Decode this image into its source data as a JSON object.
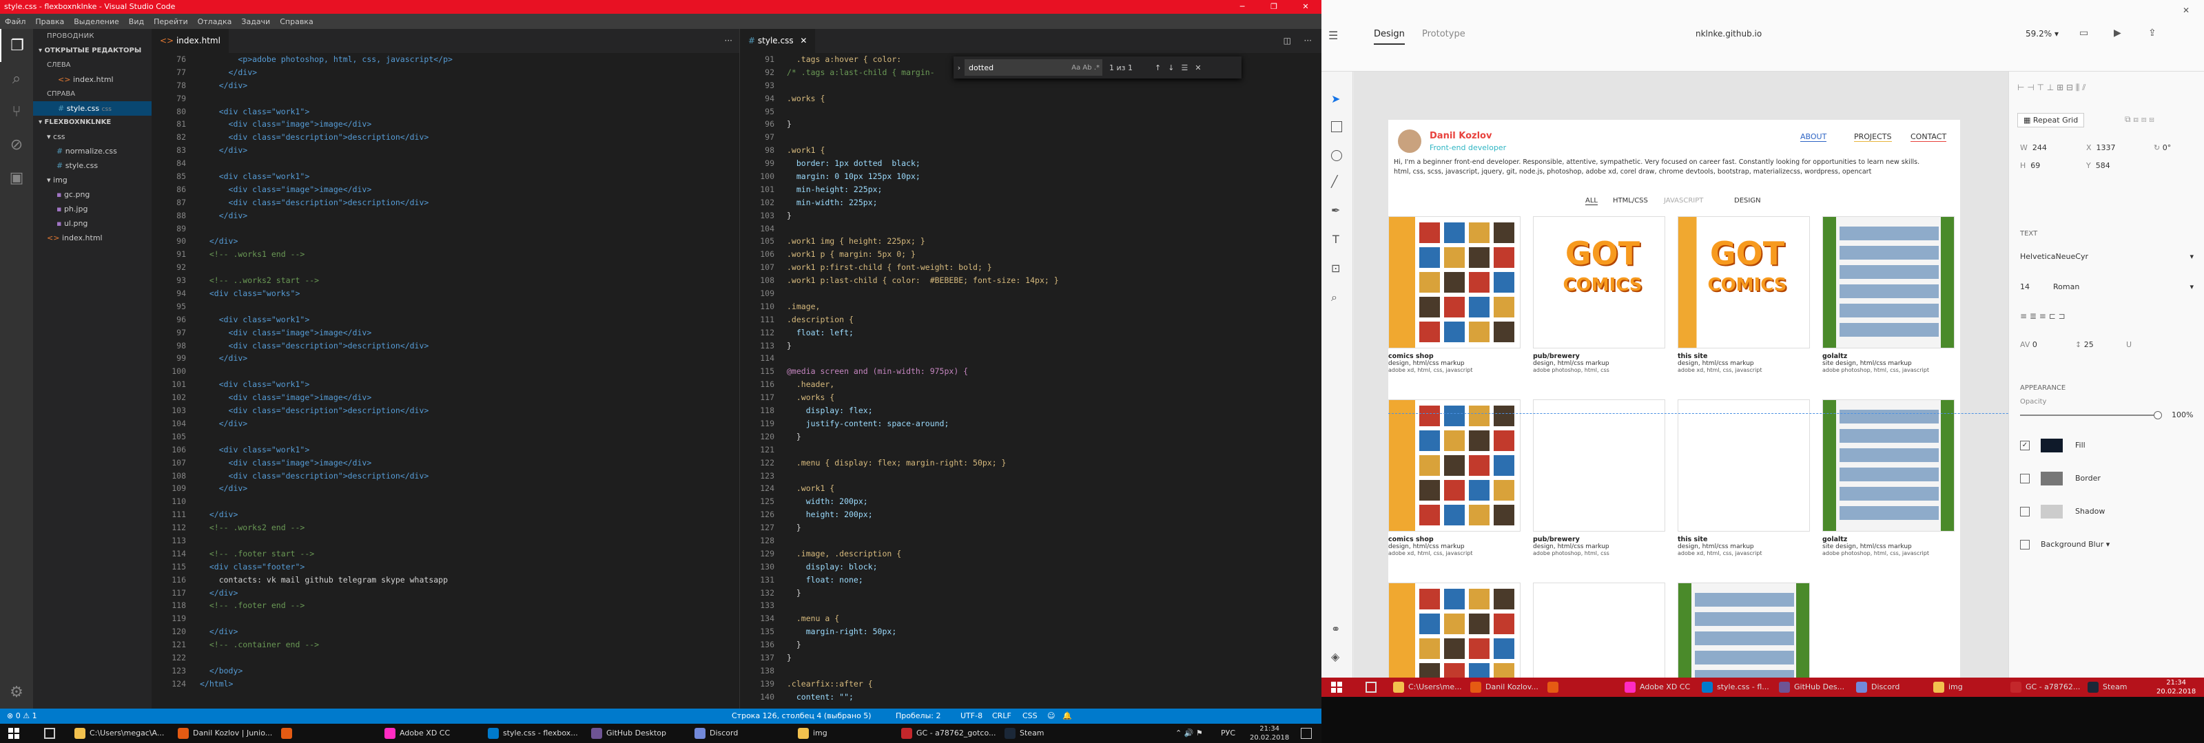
{
  "vscode": {
    "window_title": "style.css - flexboxnklnke - Visual Studio Code",
    "menu": [
      "Файл",
      "Правка",
      "Выделение",
      "Вид",
      "Перейти",
      "Отладка",
      "Задачи",
      "Справка"
    ],
    "explorer": {
      "title": "ПРОВОДНИК",
      "open_editors": "ОТКРЫТЫЕ РЕДАКТОРЫ",
      "group_left": "СЛЕВА",
      "left_file": "index.html",
      "group_right": "СПРАВА",
      "right_file": "style.css",
      "right_file_path": "css",
      "project": "FLEXBOXNKLNKE",
      "tree": [
        {
          "label": "css",
          "indent": 1,
          "type": "folder"
        },
        {
          "label": "normalize.css",
          "indent": 2,
          "type": "css"
        },
        {
          "label": "style.css",
          "indent": 2,
          "type": "css"
        },
        {
          "label": "img",
          "indent": 1,
          "type": "folder"
        },
        {
          "label": "gc.png",
          "indent": 2,
          "type": "img"
        },
        {
          "label": "ph.jpg",
          "indent": 2,
          "type": "img"
        },
        {
          "label": "ul.png",
          "indent": 2,
          "type": "img"
        },
        {
          "label": "index.html",
          "indent": 1,
          "type": "html"
        }
      ]
    },
    "left_tab": "index.html",
    "right_tab": "style.css",
    "html_lines": [
      {
        "n": "76",
        "t": "        <p>adobe photoshop, html, css, javascript</p>"
      },
      {
        "n": "77",
        "t": "      </div>"
      },
      {
        "n": "78",
        "t": "    </div>"
      },
      {
        "n": "79",
        "t": ""
      },
      {
        "n": "80",
        "t": "    <div class=\"work1\">"
      },
      {
        "n": "81",
        "t": "      <div class=\"image\">image</div>"
      },
      {
        "n": "82",
        "t": "      <div class=\"description\">description</div>"
      },
      {
        "n": "83",
        "t": "    </div>"
      },
      {
        "n": "84",
        "t": ""
      },
      {
        "n": "85",
        "t": "    <div class=\"work1\">"
      },
      {
        "n": "86",
        "t": "      <div class=\"image\">image</div>"
      },
      {
        "n": "87",
        "t": "      <div class=\"description\">description</div>"
      },
      {
        "n": "88",
        "t": "    </div>"
      },
      {
        "n": "89",
        "t": ""
      },
      {
        "n": "90",
        "t": "  </div>"
      },
      {
        "n": "91",
        "t": "  <!-- .works1 end -->"
      },
      {
        "n": "92",
        "t": ""
      },
      {
        "n": "93",
        "t": "  <!-- ..works2 start -->"
      },
      {
        "n": "94",
        "t": "  <div class=\"works\">"
      },
      {
        "n": "95",
        "t": ""
      },
      {
        "n": "96",
        "t": "    <div class=\"work1\">"
      },
      {
        "n": "97",
        "t": "      <div class=\"image\">image</div>"
      },
      {
        "n": "98",
        "t": "      <div class=\"description\">description</div>"
      },
      {
        "n": "99",
        "t": "    </div>"
      },
      {
        "n": "100",
        "t": ""
      },
      {
        "n": "101",
        "t": "    <div class=\"work1\">"
      },
      {
        "n": "102",
        "t": "      <div class=\"image\">image</div>"
      },
      {
        "n": "103",
        "t": "      <div class=\"description\">description</div>"
      },
      {
        "n": "104",
        "t": "    </div>"
      },
      {
        "n": "105",
        "t": ""
      },
      {
        "n": "106",
        "t": "    <div class=\"work1\">"
      },
      {
        "n": "107",
        "t": "      <div class=\"image\">image</div>"
      },
      {
        "n": "108",
        "t": "      <div class=\"description\">description</div>"
      },
      {
        "n": "109",
        "t": "    </div>"
      },
      {
        "n": "110",
        "t": ""
      },
      {
        "n": "111",
        "t": "  </div>"
      },
      {
        "n": "112",
        "t": "  <!-- .works2 end -->"
      },
      {
        "n": "113",
        "t": ""
      },
      {
        "n": "114",
        "t": "  <!-- .footer start -->"
      },
      {
        "n": "115",
        "t": "  <div class=\"footer\">"
      },
      {
        "n": "116",
        "t": "    contacts: vk mail github telegram skype whatsapp"
      },
      {
        "n": "117",
        "t": "  </div>"
      },
      {
        "n": "118",
        "t": "  <!-- .footer end -->"
      },
      {
        "n": "119",
        "t": ""
      },
      {
        "n": "120",
        "t": "  </div>"
      },
      {
        "n": "121",
        "t": "  <!-- .container end -->"
      },
      {
        "n": "122",
        "t": ""
      },
      {
        "n": "123",
        "t": "  </body>"
      },
      {
        "n": "124",
        "t": "</html>"
      }
    ],
    "css_lines": [
      {
        "n": "91",
        "t": "  .tags a:hover { color: "
      },
      {
        "n": "92",
        "t": "/* .tags a:last-child { margin-"
      },
      {
        "n": "93",
        "t": ""
      },
      {
        "n": "94",
        "t": ".works {"
      },
      {
        "n": "95",
        "t": ""
      },
      {
        "n": "96",
        "t": "}"
      },
      {
        "n": "97",
        "t": ""
      },
      {
        "n": "98",
        "t": ".work1 {"
      },
      {
        "n": "99",
        "t": "  border: 1px dotted  black;"
      },
      {
        "n": "100",
        "t": "  margin: 0 10px 125px 10px;"
      },
      {
        "n": "101",
        "t": "  min-height: 225px;"
      },
      {
        "n": "102",
        "t": "  min-width: 225px;"
      },
      {
        "n": "103",
        "t": "}"
      },
      {
        "n": "104",
        "t": ""
      },
      {
        "n": "105",
        "t": ".work1 img { height: 225px; }"
      },
      {
        "n": "106",
        "t": ".work1 p { margin: 5px 0; }"
      },
      {
        "n": "107",
        "t": ".work1 p:first-child { font-weight: bold; }"
      },
      {
        "n": "108",
        "t": ".work1 p:last-child { color:  #BEBEBE; font-size: 14px; }"
      },
      {
        "n": "109",
        "t": ""
      },
      {
        "n": "110",
        "t": ".image,"
      },
      {
        "n": "111",
        "t": ".description {"
      },
      {
        "n": "112",
        "t": "  float: left;"
      },
      {
        "n": "113",
        "t": "}"
      },
      {
        "n": "114",
        "t": ""
      },
      {
        "n": "115",
        "t": "@media screen and (min-width: 975px) {"
      },
      {
        "n": "116",
        "t": "  .header,"
      },
      {
        "n": "117",
        "t": "  .works {"
      },
      {
        "n": "118",
        "t": "    display: flex;"
      },
      {
        "n": "119",
        "t": "    justify-content: space-around;"
      },
      {
        "n": "120",
        "t": "  }"
      },
      {
        "n": "121",
        "t": ""
      },
      {
        "n": "122",
        "t": "  .menu { display: flex; margin-right: 50px; }"
      },
      {
        "n": "123",
        "t": ""
      },
      {
        "n": "124",
        "t": "  .work1 {"
      },
      {
        "n": "125",
        "t": "    width: 200px;"
      },
      {
        "n": "126",
        "t": "    height: 200px;"
      },
      {
        "n": "127",
        "t": "  }"
      },
      {
        "n": "128",
        "t": ""
      },
      {
        "n": "129",
        "t": "  .image, .description {"
      },
      {
        "n": "130",
        "t": "    display: block;"
      },
      {
        "n": "131",
        "t": "    float: none;"
      },
      {
        "n": "132",
        "t": "  }"
      },
      {
        "n": "133",
        "t": ""
      },
      {
        "n": "134",
        "t": "  .menu a {"
      },
      {
        "n": "135",
        "t": "    margin-right: 50px;"
      },
      {
        "n": "136",
        "t": "  }"
      },
      {
        "n": "137",
        "t": "}"
      },
      {
        "n": "138",
        "t": ""
      },
      {
        "n": "139",
        "t": ".clearfix::after {"
      },
      {
        "n": "140",
        "t": "  content: \"\";"
      }
    ],
    "find": {
      "value": "dotted",
      "count": "1 из 1",
      "case": "Aa",
      "word": "Ab",
      "regex": ".*"
    },
    "status": {
      "left": "⊗ 0 ⚠ 1",
      "position": "Строка 126, столбец 4 (выбрано 5)",
      "spaces": "Пробелы: 2",
      "encoding": "UTF-8",
      "eol": "CRLF",
      "lang": "CSS"
    }
  },
  "taskbar_left": {
    "items": [
      {
        "label": "C:\\Users\\megac\\A...",
        "color": "#f2c14e"
      },
      {
        "label": "Danil Kozlov | Junio...",
        "color": "#e55b13"
      },
      {
        "label": "",
        "color": "#e55b13"
      },
      {
        "label": "Adobe XD CC",
        "color": "#ff2bc2"
      },
      {
        "label": "style.css - flexbox...",
        "color": "#007acc"
      },
      {
        "label": "GitHub Desktop",
        "color": "#6e5494"
      },
      {
        "label": "Discord",
        "color": "#7289da"
      },
      {
        "label": "img",
        "color": "#f2c14e"
      },
      {
        "label": "GC - a78762_gotco...",
        "color": "#c3272b"
      },
      {
        "label": "Steam",
        "color": "#1b2838"
      }
    ],
    "tray": "РУС",
    "time": "21:34",
    "date": "20.02.2018"
  },
  "xd": {
    "tabs": [
      "Design",
      "Prototype"
    ],
    "doc_title": "nklnke.github.io",
    "zoom": "59.2%",
    "site": {
      "name": "Danil Kozlov",
      "role": "Front-end developer",
      "nav": [
        "ABOUT",
        "PROJECTS",
        "CONTACT"
      ],
      "bio1": "Hi, I'm a beginner front-end developer. Responsible, attentive, sympathetic. Very focused on career fast. Constantly looking for opportunities to learn new skills.",
      "bio2": "html, css, scss, javascript, jquery, git, node.js, photoshop, adobe xd, corel draw, chrome devtools, bootstrap, materializecss, wordpress, opencart",
      "filters": [
        "ALL",
        "HTML/CSS",
        "JAVASCRIPT",
        "DESIGN"
      ],
      "cards": [
        {
          "title": "comics shop",
          "desc": "design, html/css markup",
          "tools": "adobe xd, html, css, javascript",
          "kind": "comics"
        },
        {
          "title": "pub/brewery",
          "desc": "design, html/css markup",
          "tools": "adobe photoshop, html, css",
          "kind": "got"
        },
        {
          "title": "this site",
          "desc": "design, html/css markup",
          "tools": "adobe xd, html, css, javascript",
          "kind": "gotcomics"
        },
        {
          "title": "golaltz",
          "desc": "site design, html/css markup",
          "tools": "adobe photoshop, html, css, javascript",
          "kind": "sport"
        },
        {
          "title": "comics shop",
          "desc": "design, html/css markup",
          "tools": "adobe xd, html, css, javascript",
          "kind": "comics"
        },
        {
          "title": "pub/brewery",
          "desc": "design, html/css markup",
          "tools": "adobe photoshop, html, css",
          "kind": "blank"
        },
        {
          "title": "this site",
          "desc": "design, html/css markup",
          "tools": "adobe xd, html, css, javascript",
          "kind": "blank"
        },
        {
          "title": "golaltz",
          "desc": "site design, html/css markup",
          "tools": "adobe photoshop, html, css, javascript",
          "kind": "sport"
        },
        {
          "title": "",
          "desc": "",
          "tools": "",
          "kind": "comics"
        },
        {
          "title": "",
          "desc": "",
          "tools": "",
          "kind": "blank"
        },
        {
          "title": "",
          "desc": "",
          "tools": "",
          "kind": "sport"
        }
      ],
      "got_text": "GOT",
      "comics_text": "COMICS"
    },
    "panel": {
      "repeat_grid": "Repeat Grid",
      "w": "244",
      "x": "1337",
      "rot": "0°",
      "h": "69",
      "y": "584",
      "text_header": "TEXT",
      "font": "HelveticaNeueCyr",
      "size": "14",
      "weight": "Roman",
      "spacing": "0",
      "line": "25",
      "appearance": "APPEARANCE",
      "opacity": "Opacity",
      "opacity_val": "100%",
      "fill": "Fill",
      "border": "Border",
      "shadow": "Shadow",
      "bg_blur": "Background Blur"
    }
  },
  "taskbar_right": {
    "items": [
      {
        "label": "C:\\Users\\me...",
        "color": "#f2c14e"
      },
      {
        "label": "Danil Kozlov...",
        "color": "#e55b13"
      },
      {
        "label": "",
        "color": "#e55b13"
      },
      {
        "label": "Adobe XD CC",
        "color": "#ff2bc2"
      },
      {
        "label": "style.css - fl...",
        "color": "#007acc"
      },
      {
        "label": "GitHub Des...",
        "color": "#6e5494"
      },
      {
        "label": "Discord",
        "color": "#7289da"
      },
      {
        "label": "img",
        "color": "#f2c14e"
      },
      {
        "label": "GC - a78762...",
        "color": "#c3272b"
      },
      {
        "label": "Steam",
        "color": "#1b2838"
      }
    ],
    "time": "21:34",
    "date": "20.02.2018"
  }
}
